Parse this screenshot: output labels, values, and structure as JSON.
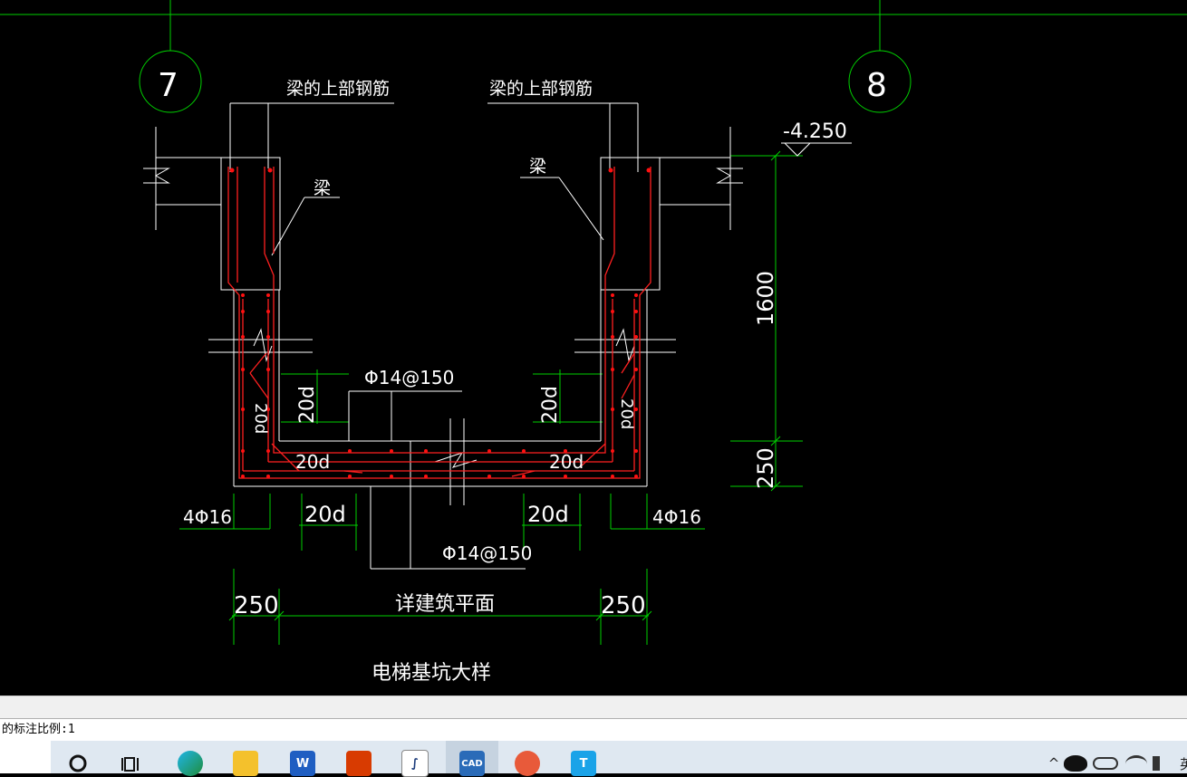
{
  "drawing": {
    "axis_left": "7",
    "axis_right": "8",
    "beam_top_rebar_left": "梁的上部钢筋",
    "beam_top_rebar_right": "梁的上部钢筋",
    "beam_left": "梁",
    "beam_right": "梁",
    "elevation": "-4.250",
    "dim_1600": "1600",
    "dim_250_vert": "250",
    "rebar_spacing_top": "Φ14@150",
    "rebar_spacing_bottom": "Φ14@150",
    "dim_20d_1": "20d",
    "dim_20d_2": "20d",
    "dim_20d_3": "20d",
    "dim_20d_4": "20d",
    "dim_20d_5": "20d",
    "dim_20d_6": "20d",
    "dim_20d_7": "20d",
    "dim_20d_8": "20d",
    "rebar_left": "4Φ16",
    "rebar_right": "4Φ16",
    "dim_250_left": "250",
    "dim_250_right": "250",
    "see_arch_plan": "详建筑平面",
    "title": "电梯基坑大样"
  },
  "command": {
    "text": "的标注比例:1"
  },
  "taskbar": {
    "items": [
      {
        "name": "search",
        "icon": "search-icon"
      },
      {
        "name": "task-view",
        "icon": "task-view-icon"
      },
      {
        "name": "edge",
        "icon": "edge-icon"
      },
      {
        "name": "file-explorer",
        "icon": "folder-icon"
      },
      {
        "name": "word",
        "icon": "word-icon",
        "label": "W"
      },
      {
        "name": "office",
        "icon": "office-icon"
      },
      {
        "name": "app-pen",
        "icon": "pen-icon"
      },
      {
        "name": "cad",
        "icon": "cad-icon",
        "label": "CAD"
      },
      {
        "name": "app-tool",
        "icon": "tool-icon"
      },
      {
        "name": "app-t",
        "icon": "t-icon",
        "label": "T"
      }
    ],
    "tray": {
      "chevron": "^",
      "ime": "英"
    }
  }
}
